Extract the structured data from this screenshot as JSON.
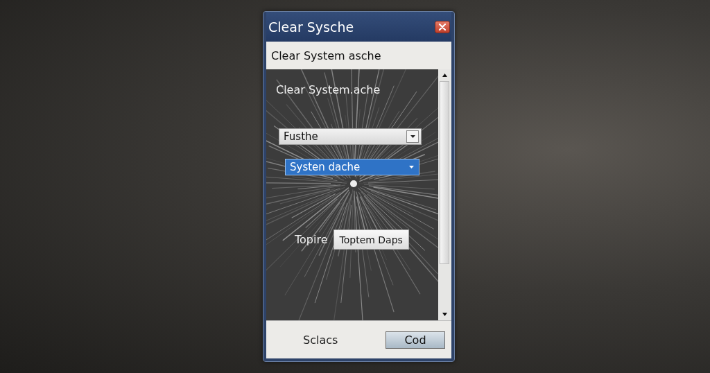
{
  "window": {
    "title": "Clear Sysche"
  },
  "header": {
    "title": "Clear System asche"
  },
  "panel": {
    "heading": "Clear System.ache",
    "dropdowns": [
      {
        "value": "Fusthe",
        "selected": false
      },
      {
        "value": "Systen dache",
        "selected": true
      }
    ],
    "action": {
      "label": "Topire",
      "button": "Toptem Daps"
    }
  },
  "footer": [
    {
      "kind": "text",
      "label": "Sclacs"
    },
    {
      "kind": "button",
      "label": "Cod"
    }
  ]
}
